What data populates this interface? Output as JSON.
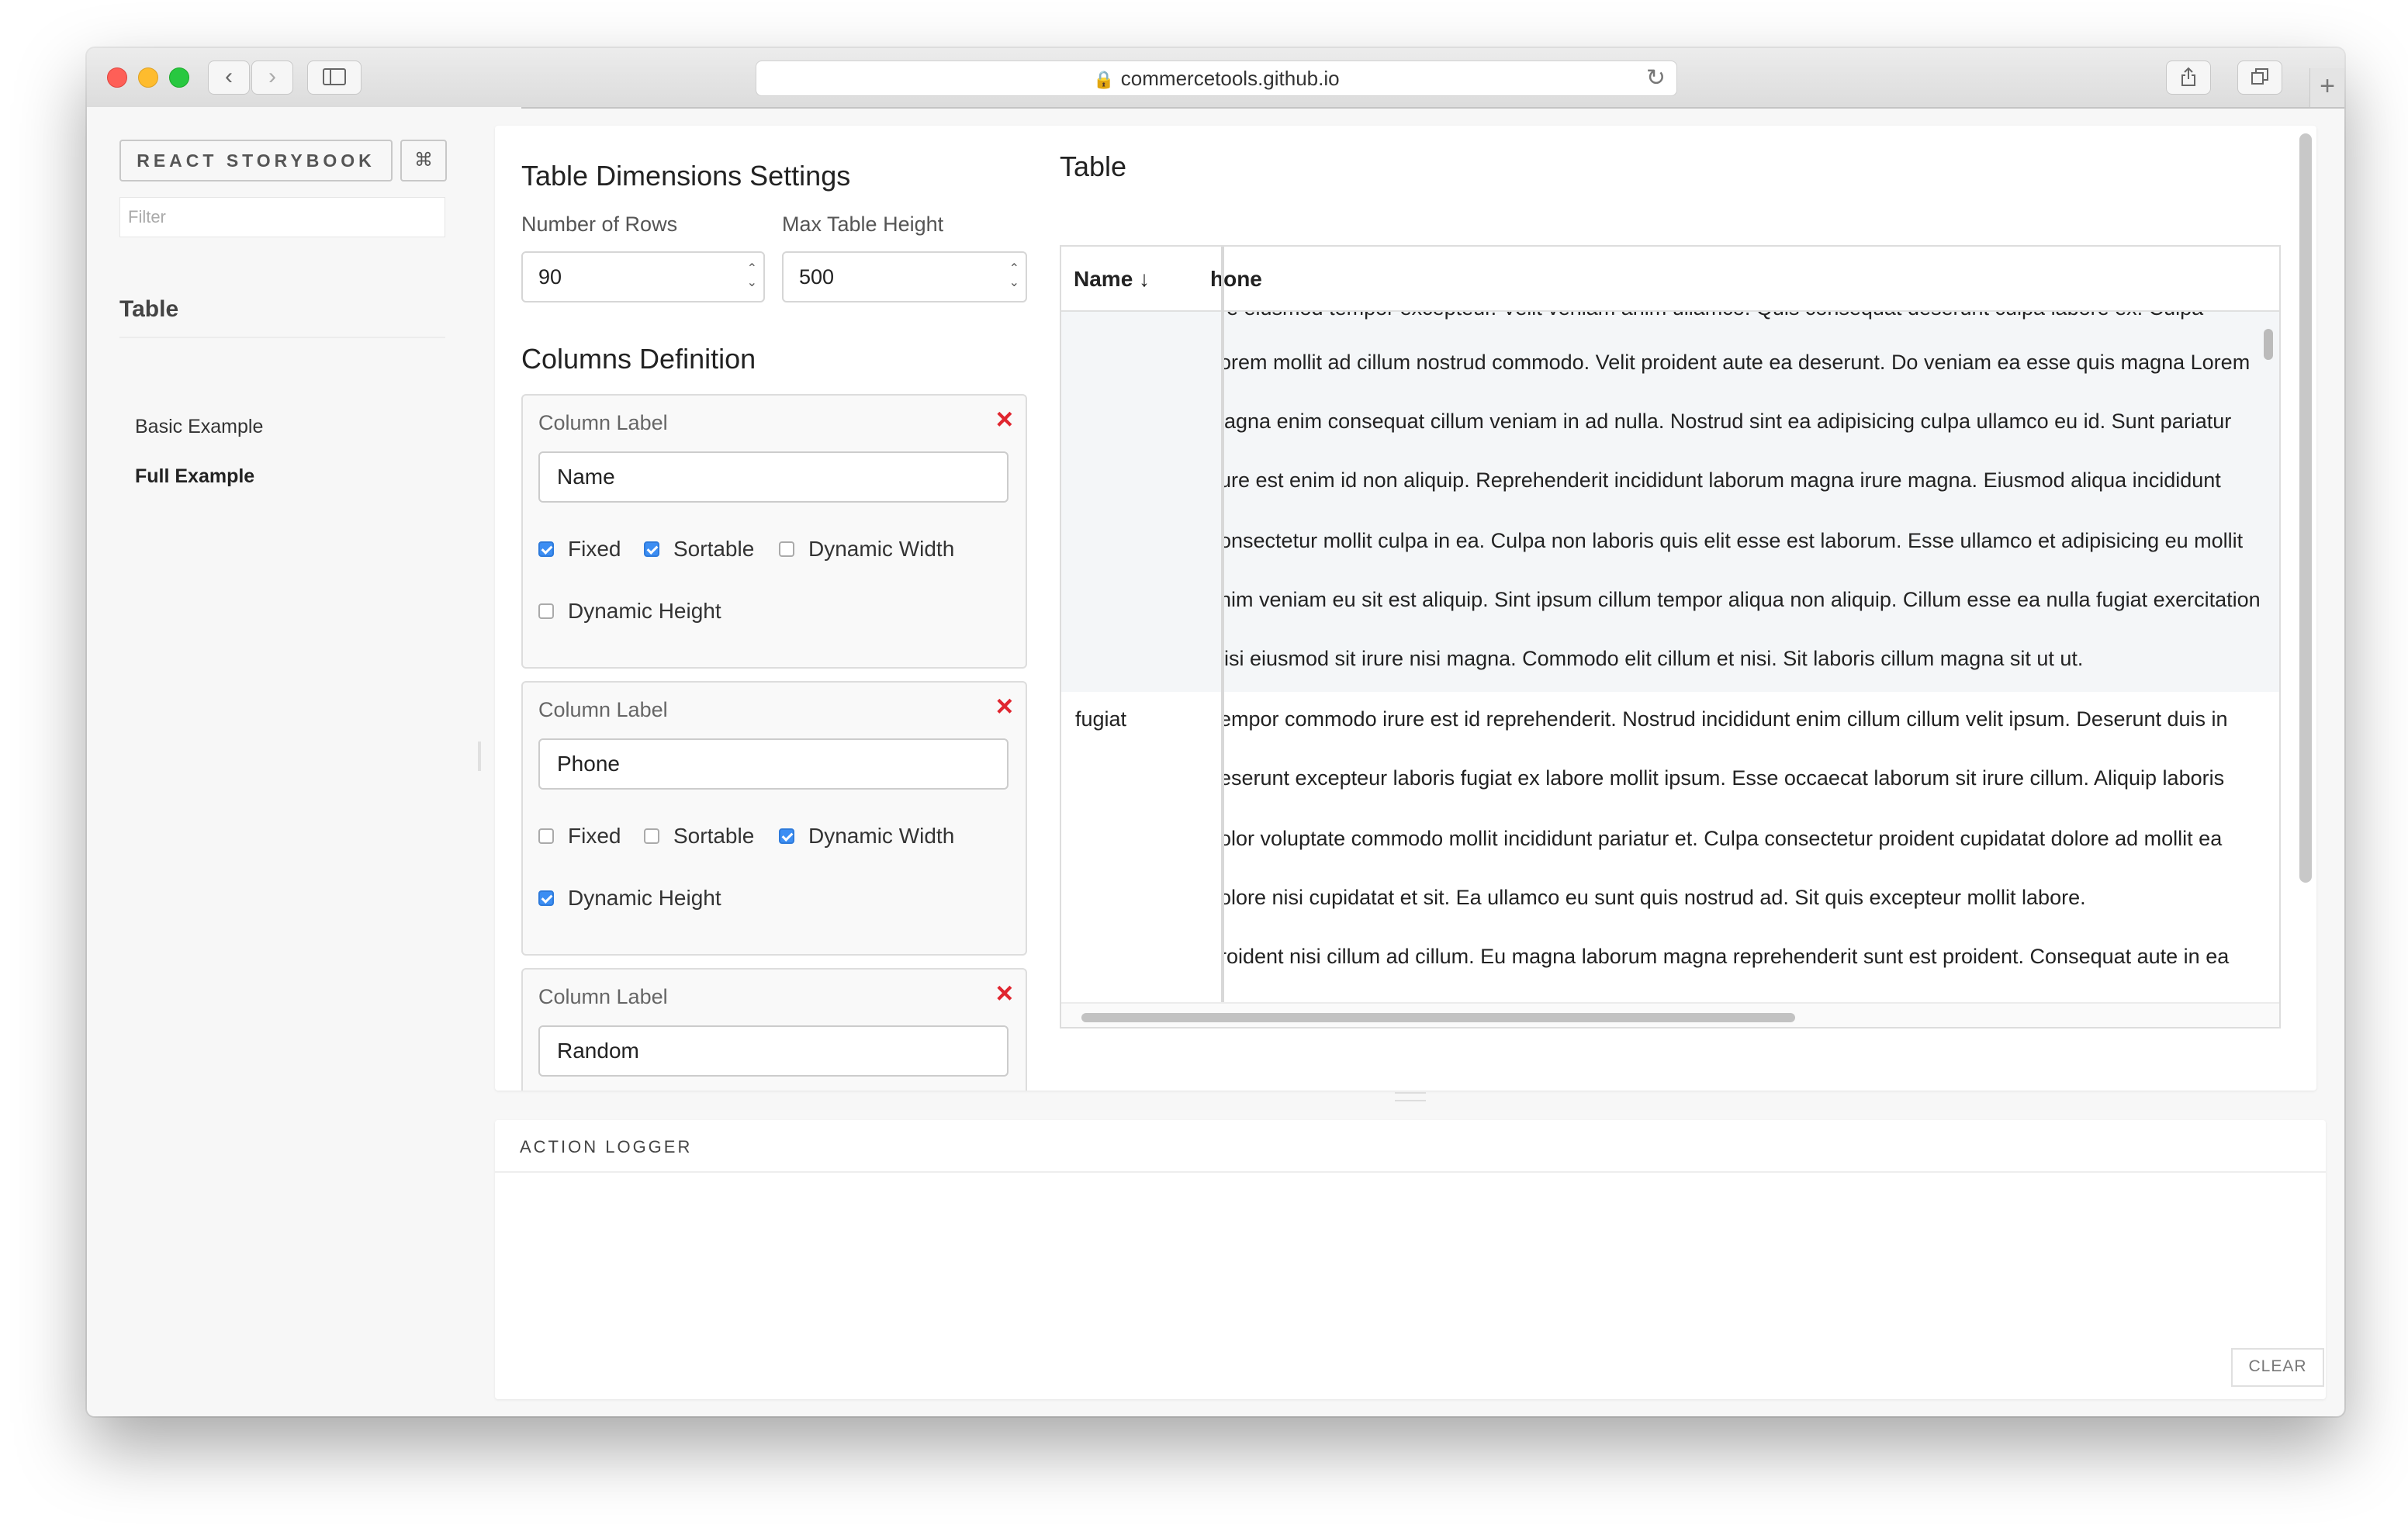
{
  "browser": {
    "url": "commercetools.github.io"
  },
  "sidebar": {
    "brand": "REACT STORYBOOK",
    "shortcut": "⌘",
    "filter_placeholder": "Filter",
    "section": "Table",
    "items": [
      {
        "label": "Basic Example",
        "active": false
      },
      {
        "label": "Full Example",
        "active": true
      }
    ]
  },
  "settings": {
    "dimensions_title": "Table Dimensions Settings",
    "rows_label": "Number of Rows",
    "rows_value": "90",
    "height_label": "Max Table Height",
    "height_value": "500",
    "columns_title": "Columns Definition",
    "columns": [
      {
        "label": "Column Label",
        "value": "Name",
        "options": [
          {
            "label": "Fixed",
            "checked": true
          },
          {
            "label": "Sortable",
            "checked": true
          },
          {
            "label": "Dynamic Width",
            "checked": false
          },
          {
            "label": "Dynamic Height",
            "checked": false
          }
        ]
      },
      {
        "label": "Column Label",
        "value": "Phone",
        "options": [
          {
            "label": "Fixed",
            "checked": false
          },
          {
            "label": "Sortable",
            "checked": false
          },
          {
            "label": "Dynamic Width",
            "checked": true
          },
          {
            "label": "Dynamic Height",
            "checked": true
          }
        ]
      },
      {
        "label": "Column Label",
        "value": "Random"
      }
    ],
    "remove_icon": "×"
  },
  "table": {
    "title": "Table",
    "header_name": "Name ↓",
    "header_phone": "hone",
    "rows": [
      {
        "name": "",
        "lines": [
          "re eiusmod tempor excepteur. Velit veniam anim ullamco. Quis consequat deserunt culpa labore ex. Culpa",
          "orem mollit ad cillum nostrud commodo. Velit proident aute ea deserunt. Do veniam ea esse quis magna Lorem",
          "lagna enim consequat cillum veniam in ad nulla. Nostrud sint ea adipisicing culpa ullamco eu id. Sunt pariatur",
          "ure est enim id non aliquip. Reprehenderit incididunt laborum magna irure magna. Eiusmod aliqua incididunt",
          "onsectetur mollit culpa in ea. Culpa non laboris quis elit esse est laborum. Esse ullamco et adipisicing eu mollit",
          "nim veniam eu sit est aliquip. Sint ipsum cillum tempor aliqua non aliquip. Cillum esse ea nulla fugiat exercitation",
          "lisi eiusmod sit irure nisi magna. Commodo elit cillum et nisi. Sit laboris cillum magna sit ut ut."
        ]
      },
      {
        "name": "fugiat",
        "lines": [
          "empor commodo irure est id reprehenderit. Nostrud incididunt enim cillum cillum velit ipsum. Deserunt duis in",
          "eserunt excepteur laboris fugiat ex labore mollit ipsum. Esse occaecat laborum sit irure cillum. Aliquip laboris",
          "olor voluptate commodo mollit incididunt pariatur et. Culpa consectetur proident cupidatat dolore ad mollit ea",
          "olore nisi cupidatat et sit. Ea ullamco eu sunt quis nostrud ad. Sit quis excepteur mollit labore.",
          "roident nisi cillum ad cillum. Eu magna laborum magna reprehenderit sunt est proident. Consequat aute in ea"
        ]
      }
    ]
  },
  "logger": {
    "title": "ACTION LOGGER",
    "clear": "CLEAR"
  },
  "colors": {
    "accent": "#3c8ef3",
    "remove": "#e0262f"
  }
}
